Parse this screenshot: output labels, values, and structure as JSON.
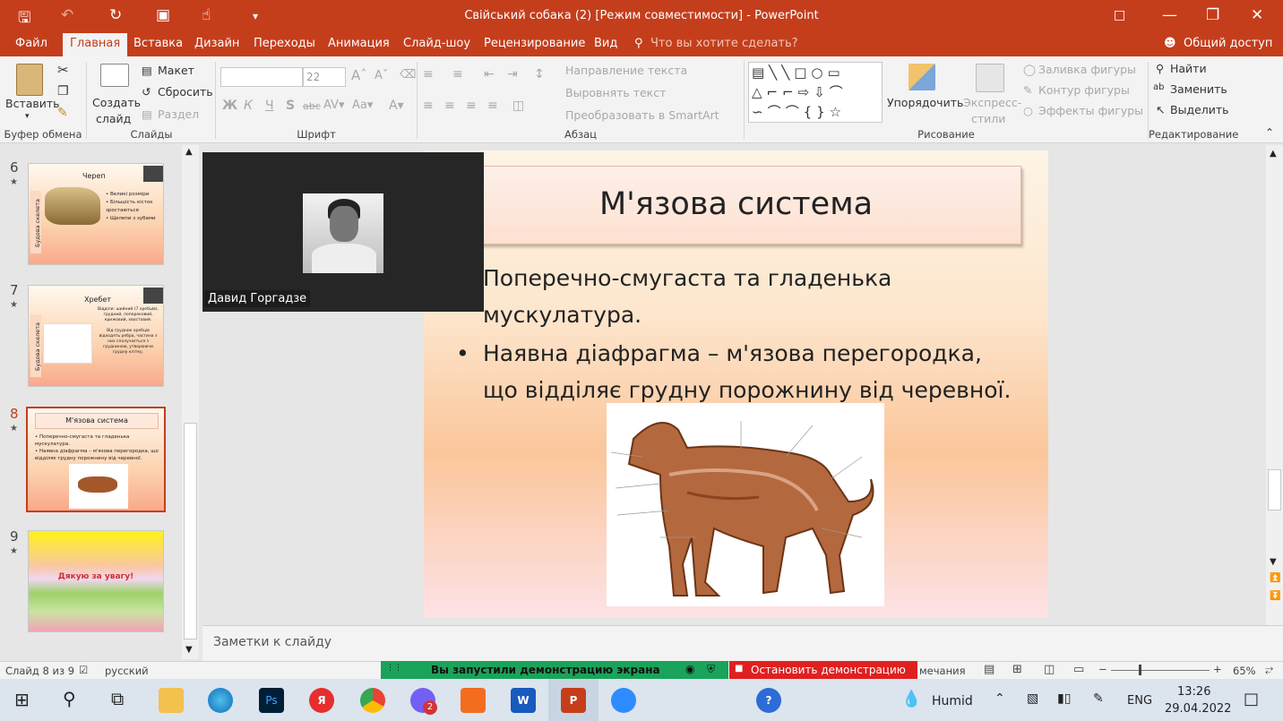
{
  "window": {
    "title": "Свійський собака (2) [Режим совместимости] - PowerPoint"
  },
  "tabs": [
    {
      "label": "Файл"
    },
    {
      "label": "Главная"
    },
    {
      "label": "Вставка"
    },
    {
      "label": "Дизайн"
    },
    {
      "label": "Переходы"
    },
    {
      "label": "Анимация"
    },
    {
      "label": "Слайд-шоу"
    },
    {
      "label": "Рецензирование"
    },
    {
      "label": "Вид"
    }
  ],
  "tellme": "Что вы хотите сделать?",
  "share": "Общий доступ",
  "ribbon": {
    "paste": "Вставить",
    "new_slide_1": "Создать",
    "new_slide_2": "слайд",
    "layout": "Макет",
    "reset": "Сбросить",
    "section": "Раздел",
    "font_size": "22",
    "bold": "Ж",
    "italic": "К",
    "underline": "Ч",
    "shadow": "S",
    "strike": "abc",
    "text_direction": "Направление текста",
    "align_text": "Выровнять текст",
    "smartart": "Преобразовать в SmartArt",
    "arrange": "Упорядочить",
    "quick_styles_1": "Экспресс-",
    "quick_styles_2": "стили",
    "shape_fill": "Заливка фигуры",
    "shape_outline": "Контур фигуры",
    "shape_effects": "Эффекты фигуры",
    "find": "Найти",
    "replace": "Заменить",
    "select": "Выделить",
    "groups": {
      "clipboard": "Буфер обмена",
      "slides": "Слайды",
      "font": "Шрифт",
      "paragraph": "Абзац",
      "drawing": "Рисование",
      "editing": "Редактирование"
    }
  },
  "thumbnails": [
    {
      "num": "6",
      "title": "Череп",
      "side": "Будова скелета",
      "text": [
        "Великі розміри",
        "Більшість кісток зростаються",
        "Щелепи з зубами"
      ]
    },
    {
      "num": "7",
      "title": "Хребет",
      "side": "Будова скелета",
      "text": [
        "Відділи: шийний (7 хребців), грудний, поперековий, крижовий, хвостовий.",
        "Від грудних хребців відходять ребра, частина з них сполучається з грудниною, утворюючи грудну клітку."
      ]
    },
    {
      "num": "8",
      "title": "М'язова система",
      "text": [
        "Поперечно-смугаста та гладенька мускулатура.",
        "Наявна діафрагма – м'язова перегородка, що відділяє грудну порожнину від черевної."
      ]
    },
    {
      "num": "9",
      "title": "Дякую за увагу!"
    }
  ],
  "slide": {
    "title": "М'язова система",
    "bullet1": "Поперечно-смугаста та гладенька мускулатура.",
    "bullet1_l1": "Поперечно-смугаста та гладенька",
    "bullet1_l2": "мускулатура.",
    "bullet2_l1": "Наявна діафрагма – м'язова перегородка,",
    "bullet2_l2": "що відділяє грудну порожнину від черевної."
  },
  "video": {
    "name": "Давид Горгадзе"
  },
  "notes_placeholder": "Заметки к слайду",
  "status": {
    "slide_of": "Слайд 8 из 9",
    "language": "русский",
    "notes": "мечания",
    "zoom": "65%"
  },
  "sharebar": {
    "text": "Вы запустили демонстрацию экрана",
    "stop": "Остановить демонстрацию"
  },
  "taskbar": {
    "weather": "Humid",
    "lang": "ENG",
    "time": "13:26",
    "date": "29.04.2022",
    "viber_badge": "2"
  },
  "colors": {
    "accent": "#c43e1c",
    "share_green": "#1aa35a",
    "stop_red": "#e02020"
  }
}
